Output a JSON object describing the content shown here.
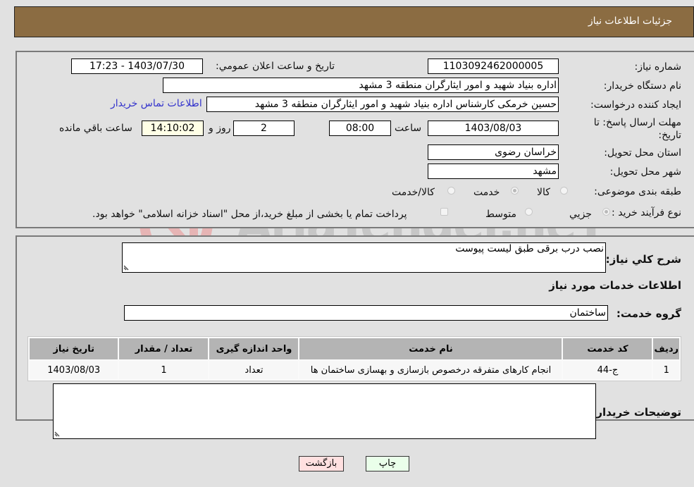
{
  "header": {
    "title": "جزئيات اطلاعات نياز"
  },
  "details": {
    "need_number": {
      "label": "شماره نياز:",
      "value": "1103092462000005"
    },
    "announce_datetime": {
      "label": "تاريخ و ساعت اعلان عمومي:",
      "value": "1403/07/30 - 17:23"
    },
    "buyer_org": {
      "label": "نام دستگاه خريدار:",
      "value": "اداره بنياد شهيد و امور ايثارگران منطقه 3 مشهد"
    },
    "requester": {
      "label": "ايجاد کننده درخواست:",
      "value": "حسين خرمکی کارشناس اداره بنياد شهيد و امور ايثارگران منطقه 3 مشهد"
    },
    "buyer_contact_link": "اطلاعات تماس خريدار",
    "deadline": {
      "label": "مهلت ارسال پاسخ: تا تاريخ:",
      "date": "1403/08/03",
      "time_label": "ساعت",
      "time": "08:00",
      "days": "2",
      "days_label": "روز و",
      "remaining": "14:10:02",
      "remaining_label": "ساعت باقي مانده"
    },
    "province": {
      "label": "استان محل تحويل:",
      "value": "خراسان رضوی"
    },
    "city": {
      "label": "شهر محل تحويل:",
      "value": "مشهد"
    },
    "category": {
      "label": "طبقه بندی موضوعی:",
      "options": [
        "کالا",
        "خدمت",
        "کالا/خدمت"
      ],
      "selected": "خدمت"
    },
    "purchase_process": {
      "label": "نوع فرآيند خريد :",
      "options": [
        "جزيي",
        "متوسط"
      ],
      "selected": "جزيي",
      "treasury_note": "پرداخت تمام يا بخشی از مبلغ خريد،از محل \"اسناد خزانه اسلامی\" خواهد بود."
    }
  },
  "need_summary": {
    "label": "شرح کلي نياز:",
    "value": "نصب درب برقی طبق ليست پيوست"
  },
  "services_section_title": "اطلاعات خدمات مورد نياز",
  "service_group": {
    "label": "گروه خدمت:",
    "value": "ساختمان"
  },
  "services_table": {
    "columns": [
      "رديف",
      "کد خدمت",
      "نام خدمت",
      "واحد اندازه گيری",
      "تعداد / مقدار",
      "تاريخ نياز"
    ],
    "rows": [
      [
        "1",
        "ج-44",
        "انجام کارهای متفرقه درخصوص بازسازی و بهسازی ساختمان ها",
        "تعداد",
        "1",
        "1403/08/03"
      ]
    ]
  },
  "buyer_notes": {
    "label": "توضيحات خريدار:",
    "value": ""
  },
  "buttons": {
    "print": "چاپ",
    "back": "بازگشت"
  },
  "watermark": {
    "text": "AriaTender.neT"
  },
  "colors": {
    "header_bg": "#8b6c42",
    "link": "#3333cc",
    "print_bg": "#eaffea",
    "back_bg": "#ffe0e0"
  }
}
